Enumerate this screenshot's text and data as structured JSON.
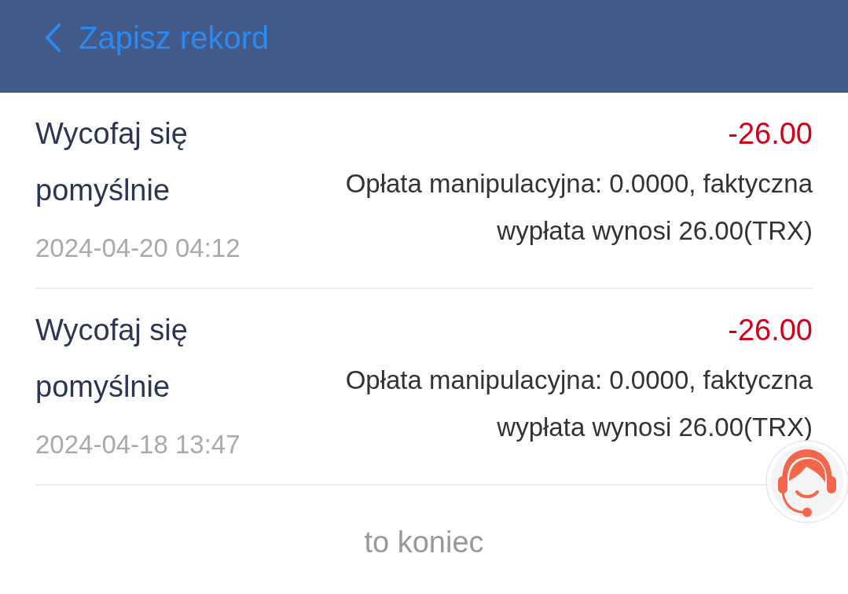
{
  "header": {
    "title": "Zapisz rekord"
  },
  "records": [
    {
      "title": "Wycofaj się pomyślnie",
      "time": "2024-04-20 04:12",
      "amount": "-26.00",
      "description": "Opłata manipulacyjna: 0.0000, faktyczna wypłata wynosi 26.00(TRX)"
    },
    {
      "title": "Wycofaj się pomyślnie",
      "time": "2024-04-18 13:47",
      "amount": "-26.00",
      "description": "Opłata manipulacyjna: 0.0000, faktyczna wypłata wynosi 26.00(TRX)"
    }
  ],
  "footer": {
    "text": "to koniec"
  }
}
